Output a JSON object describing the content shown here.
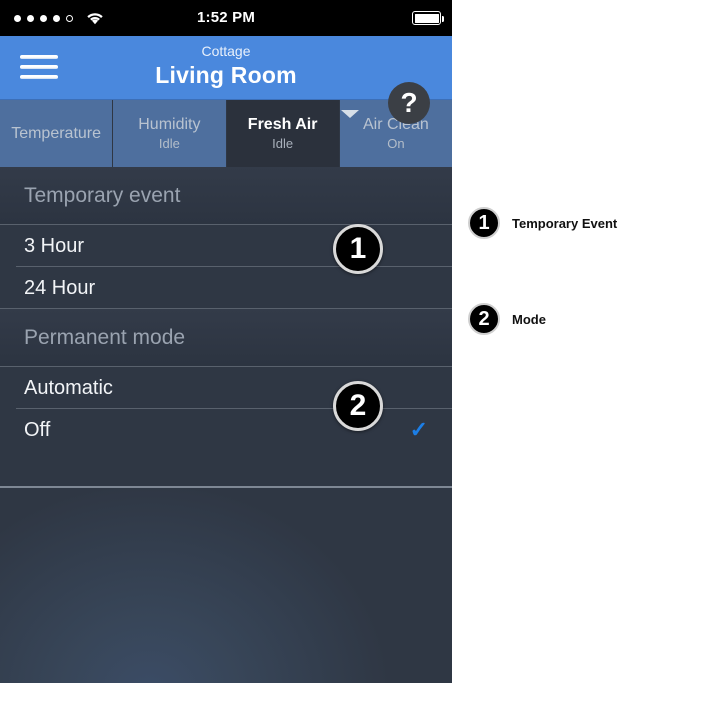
{
  "status_bar": {
    "signal_dots_filled": 4,
    "signal_dots_empty": 1,
    "wifi_icon": "wifi-icon",
    "time": "1:52 PM",
    "battery_icon": "battery-full-icon"
  },
  "navbar": {
    "menu_icon": "hamburger-icon",
    "subtitle": "Cottage",
    "title": "Living Room",
    "caret_icon": "chevron-down-icon",
    "help_label": "?",
    "background_color": "#4a88dd"
  },
  "tabs": [
    {
      "label": "Temperature",
      "sub": "",
      "active": false
    },
    {
      "label": "Humidity",
      "sub": "Idle",
      "active": false
    },
    {
      "label": "Fresh Air",
      "sub": "Idle",
      "active": true
    },
    {
      "label": "Air Clean",
      "sub": "On",
      "active": false
    }
  ],
  "sections": [
    {
      "header": "Temporary event",
      "rows": [
        {
          "label": "3 Hour",
          "checked": false
        },
        {
          "label": "24 Hour",
          "checked": false
        }
      ]
    },
    {
      "header": "Permanent mode",
      "rows": [
        {
          "label": "Automatic",
          "checked": false
        },
        {
          "label": "Off",
          "checked": true
        }
      ]
    }
  ],
  "check_mark": "✓",
  "accent_color": "#1c7ee6",
  "badges": [
    {
      "number": "1"
    },
    {
      "number": "2"
    }
  ],
  "legend": [
    {
      "number": "1",
      "label": "Temporary Event"
    },
    {
      "number": "2",
      "label": "Mode"
    }
  ]
}
